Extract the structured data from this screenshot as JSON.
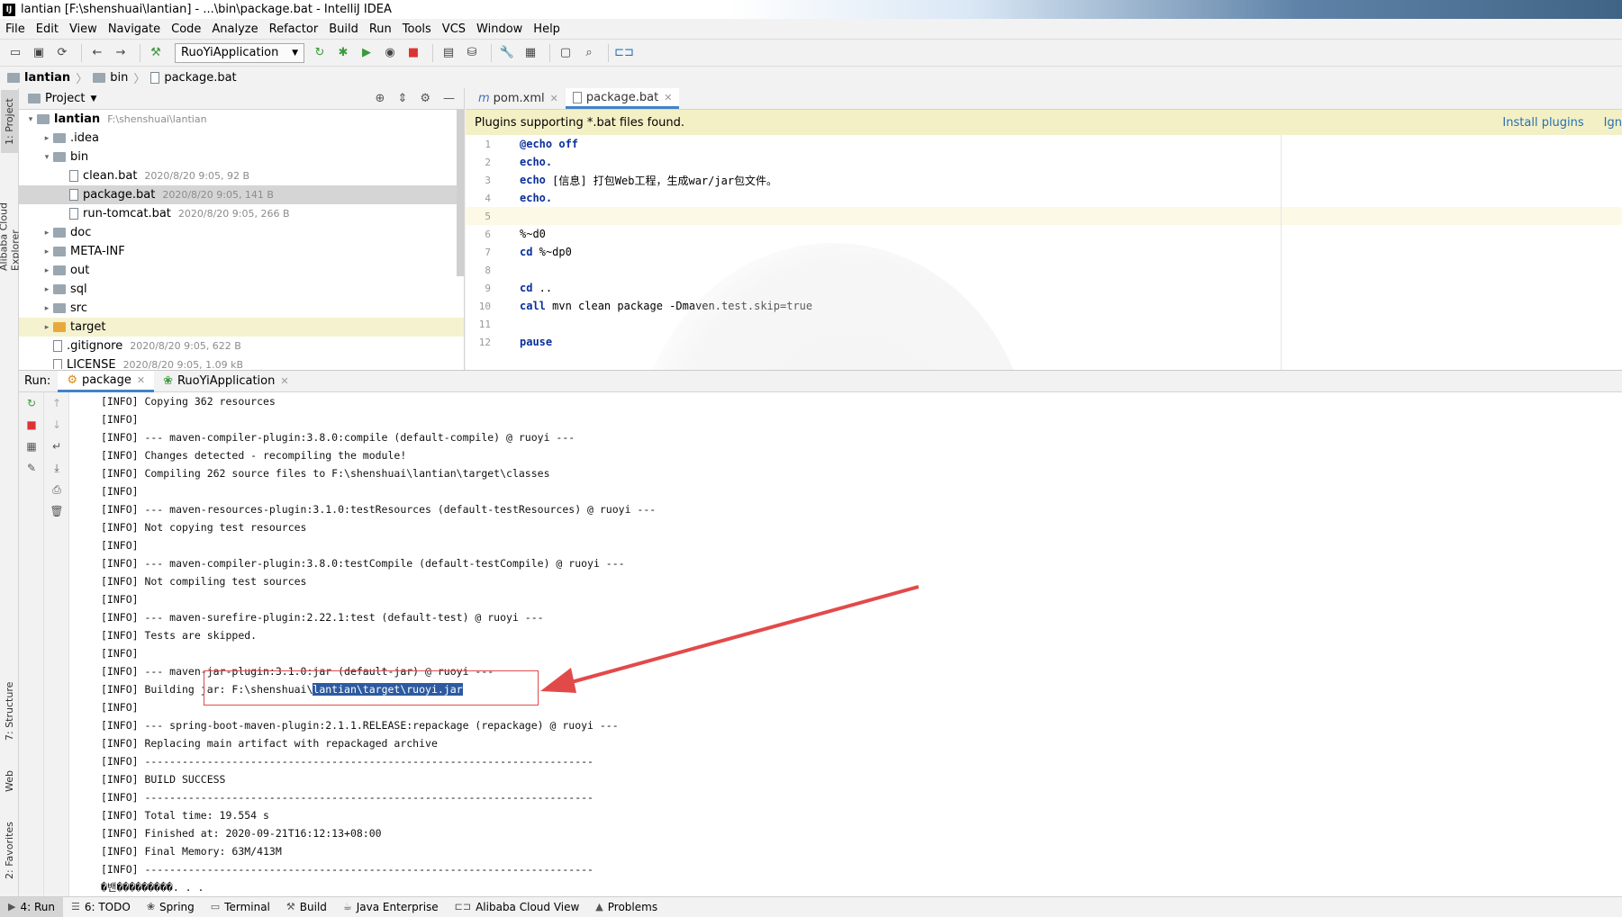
{
  "window": {
    "title": "lantian [F:\\shenshuai\\lantian] - ...\\bin\\package.bat - IntelliJ IDEA",
    "app_icon": "IJ"
  },
  "menu": [
    "File",
    "Edit",
    "View",
    "Navigate",
    "Code",
    "Analyze",
    "Refactor",
    "Build",
    "Run",
    "Tools",
    "VCS",
    "Window",
    "Help"
  ],
  "toolbar": {
    "run_config": "RuoYiApplication"
  },
  "breadcrumb": [
    "lantian",
    "bin",
    "package.bat"
  ],
  "left_strip": {
    "project": "1: Project",
    "cloud": "Alibaba Cloud Explorer",
    "structure": "7: Structure",
    "web": "Web",
    "favorites": "2: Favorites"
  },
  "project": {
    "header": "Project",
    "tree": [
      {
        "name": "lantian",
        "meta": "F:\\shenshuai\\lantian",
        "indent": 0,
        "arrow": "▾",
        "type": "folder"
      },
      {
        "name": ".idea",
        "meta": "",
        "indent": 1,
        "arrow": "▸",
        "type": "folder"
      },
      {
        "name": "bin",
        "meta": "",
        "indent": 1,
        "arrow": "▾",
        "type": "folder"
      },
      {
        "name": "clean.bat",
        "meta": "2020/8/20 9:05, 92 B",
        "indent": 2,
        "arrow": "",
        "type": "file"
      },
      {
        "name": "package.bat",
        "meta": "2020/8/20 9:05, 141 B",
        "indent": 2,
        "arrow": "",
        "type": "file",
        "selected": true
      },
      {
        "name": "run-tomcat.bat",
        "meta": "2020/8/20 9:05, 266 B",
        "indent": 2,
        "arrow": "",
        "type": "file"
      },
      {
        "name": "doc",
        "meta": "",
        "indent": 1,
        "arrow": "▸",
        "type": "folder"
      },
      {
        "name": "META-INF",
        "meta": "",
        "indent": 1,
        "arrow": "▸",
        "type": "folder"
      },
      {
        "name": "out",
        "meta": "",
        "indent": 1,
        "arrow": "▸",
        "type": "folder"
      },
      {
        "name": "sql",
        "meta": "",
        "indent": 1,
        "arrow": "▸",
        "type": "folder"
      },
      {
        "name": "src",
        "meta": "",
        "indent": 1,
        "arrow": "▸",
        "type": "folder"
      },
      {
        "name": "target",
        "meta": "",
        "indent": 1,
        "arrow": "▸",
        "type": "folder-orange",
        "highlight": true
      },
      {
        "name": ".gitignore",
        "meta": "2020/8/20 9:05, 622 B",
        "indent": 1,
        "arrow": "",
        "type": "file"
      },
      {
        "name": "LICENSE",
        "meta": "2020/8/20 9:05, 1.09 kB",
        "indent": 1,
        "arrow": "",
        "type": "file"
      }
    ]
  },
  "editor": {
    "tabs": [
      {
        "label": "pom.xml",
        "active": false
      },
      {
        "label": "package.bat",
        "active": true
      }
    ],
    "banner": {
      "text": "Plugins supporting *.bat files found.",
      "install": "Install plugins",
      "ignore": "Ign"
    },
    "lines": [
      {
        "n": "1",
        "kw": "@echo off",
        "rest": ""
      },
      {
        "n": "2",
        "kw": "echo.",
        "rest": ""
      },
      {
        "n": "3",
        "kw": "echo",
        "rest": " [信息] 打包Web工程，生成war/jar包文件。"
      },
      {
        "n": "4",
        "kw": "echo.",
        "rest": ""
      },
      {
        "n": "5",
        "kw": "",
        "rest": "",
        "current": true
      },
      {
        "n": "6",
        "kw": "",
        "rest": "%~d0"
      },
      {
        "n": "7",
        "kw": "cd",
        "rest": " %~dp0"
      },
      {
        "n": "8",
        "kw": "",
        "rest": ""
      },
      {
        "n": "9",
        "kw": "cd",
        "rest": " .."
      },
      {
        "n": "10",
        "kw": "call",
        "rest": " mvn clean package -Dmaven.test.skip=true"
      },
      {
        "n": "11",
        "kw": "",
        "rest": ""
      },
      {
        "n": "12",
        "kw": "pause",
        "rest": ""
      }
    ]
  },
  "run": {
    "label": "Run:",
    "tabs": [
      {
        "label": "package",
        "active": true
      },
      {
        "label": "RuoYiApplication",
        "active": false
      }
    ],
    "console": [
      "[INFO] Copying 362 resources",
      "[INFO]",
      "[INFO] --- maven-compiler-plugin:3.8.0:compile (default-compile) @ ruoyi ---",
      "[INFO] Changes detected - recompiling the module!",
      "[INFO] Compiling 262 source files to F:\\shenshuai\\lantian\\target\\classes",
      "[INFO]",
      "[INFO] --- maven-resources-plugin:3.1.0:testResources (default-testResources) @ ruoyi ---",
      "[INFO] Not copying test resources",
      "[INFO]",
      "[INFO] --- maven-compiler-plugin:3.8.0:testCompile (default-testCompile) @ ruoyi ---",
      "[INFO] Not compiling test sources",
      "[INFO]",
      "[INFO] --- maven-surefire-plugin:2.22.1:test (default-test) @ ruoyi ---",
      "[INFO] Tests are skipped.",
      "[INFO]",
      "[INFO] --- maven-jar-plugin:3.1.0:jar (default-jar) @ ruoyi ---",
      "__BUILDING_JAR__",
      "[INFO]",
      "[INFO] --- spring-boot-maven-plugin:2.1.1.RELEASE:repackage (repackage) @ ruoyi ---",
      "[INFO] Replacing main artifact with repackaged archive",
      "[INFO] ------------------------------------------------------------------------",
      "[INFO] BUILD SUCCESS",
      "[INFO] ------------------------------------------------------------------------",
      "[INFO] Total time: 19.554 s",
      "[INFO] Finished at: 2020-09-21T16:12:13+08:00",
      "[INFO] Final Memory: 63M/413M",
      "[INFO] ------------------------------------------------------------------------",
      "�밴���������. . ."
    ],
    "building_jar": {
      "prefix": "[INFO] Building jar: F:\\shenshuai\\",
      "selected": "lantian\\target\\ruoyi.jar"
    }
  },
  "statusbar": [
    {
      "label": "4: Run",
      "icon": "run-icon",
      "active": true
    },
    {
      "label": "6: TODO",
      "icon": "todo-icon"
    },
    {
      "label": "Spring",
      "icon": "spring-icon"
    },
    {
      "label": "Terminal",
      "icon": "terminal-icon"
    },
    {
      "label": "Build",
      "icon": "build-icon"
    },
    {
      "label": "Java Enterprise",
      "icon": "java-enterprise-icon"
    },
    {
      "label": "Alibaba Cloud View",
      "icon": "cloud-icon"
    },
    {
      "label": "Problems",
      "icon": "warning-icon"
    }
  ],
  "colors": {
    "selection": "#2d5aa0",
    "annotation_red": "#e24a4a",
    "keyword": "#0b2f9b",
    "banner": "#f4f0c6"
  }
}
